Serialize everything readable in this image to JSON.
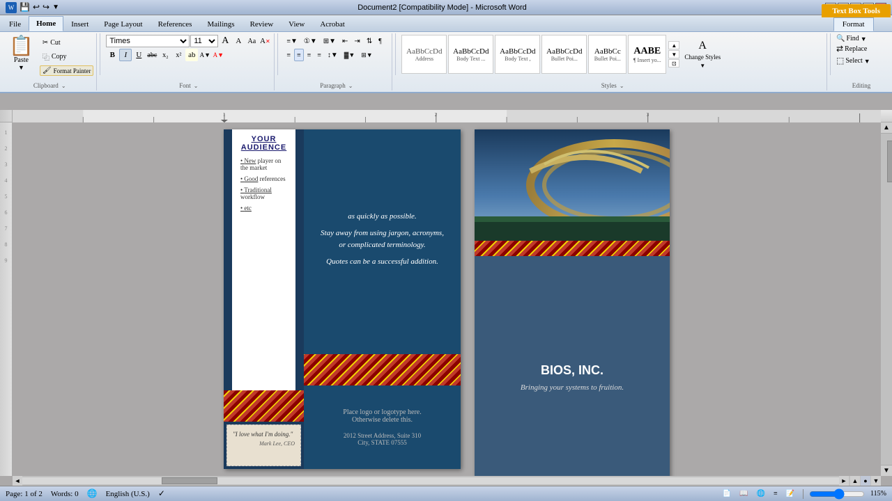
{
  "titlebar": {
    "title": "Document2 [Compatibility Mode] - Microsoft Word",
    "controls": [
      "minimize",
      "maximize",
      "close"
    ]
  },
  "textboxtoolbar": {
    "label": "Text Box Tools"
  },
  "tabs": {
    "file": "File",
    "home": "Home",
    "insert": "Insert",
    "page_layout": "Page Layout",
    "references": "References",
    "mailings": "Mailings",
    "review": "Review",
    "view": "View",
    "acrobat": "Acrobat",
    "format": "Format"
  },
  "ribbon": {
    "clipboard": {
      "label": "Clipboard",
      "paste": "Paste",
      "cut": "Cut",
      "copy": "Copy",
      "format_painter": "Format Painter"
    },
    "font": {
      "label": "Font",
      "font_name": "Times",
      "font_size": "11",
      "bold": "B",
      "italic": "I",
      "underline": "U",
      "strikethrough": "abc",
      "subscript": "x₂",
      "superscript": "x²",
      "grow": "A",
      "shrink": "A",
      "case": "Aa",
      "clear": "A"
    },
    "paragraph": {
      "label": "Paragraph"
    },
    "styles": {
      "label": "Styles",
      "items": [
        {
          "name": "Address",
          "preview": "AaBbCcDd"
        },
        {
          "name": "Body Text ...",
          "preview": "AaBbCcDd"
        },
        {
          "name": "Body Text ,",
          "preview": "AaBbCcDd"
        },
        {
          "name": "Bullet Poi...",
          "preview": "AaBbCcDd"
        },
        {
          "name": "Bullet Poi...",
          "preview": "AaBbCc"
        },
        {
          "name": "¶ Insert yo...",
          "preview": "AABE"
        },
        {
          "name": "Change Styles",
          "preview": ""
        },
        {
          "name": "Select",
          "preview": ""
        }
      ],
      "change_styles": "Change Styles",
      "select": "Select"
    },
    "editing": {
      "label": "Editing",
      "find": "Find",
      "replace": "Replace",
      "select": "Select"
    }
  },
  "document": {
    "page_info": "Page: 1 of 2",
    "words": "Words: 0",
    "language": "English (U.S.)",
    "zoom": "115%"
  },
  "content": {
    "col1": {
      "heading": "YOUR AUDIENCE",
      "bullets": [
        "• New player on the market",
        "• Good references",
        "• Traditional workflow",
        "• etc"
      ]
    },
    "col2": {
      "lines": [
        "as quickly as possible.",
        "",
        "Stay away from using jargon, acronyms,",
        "or complicated terminology.",
        "",
        "Quotes can be a successful addition.",
        "",
        "Place logo  or logotype here.",
        "Otherwise delete this.",
        "",
        "2012 Street Address,  Suite 310",
        "City, STATE 07555"
      ]
    },
    "col3": {
      "company": "BIOS, INC.",
      "tagline": "Bringing your systems to fruition."
    },
    "quote": {
      "text": "\"I love what I'm doing.\"",
      "author": "Mark Lee, CEO"
    }
  }
}
